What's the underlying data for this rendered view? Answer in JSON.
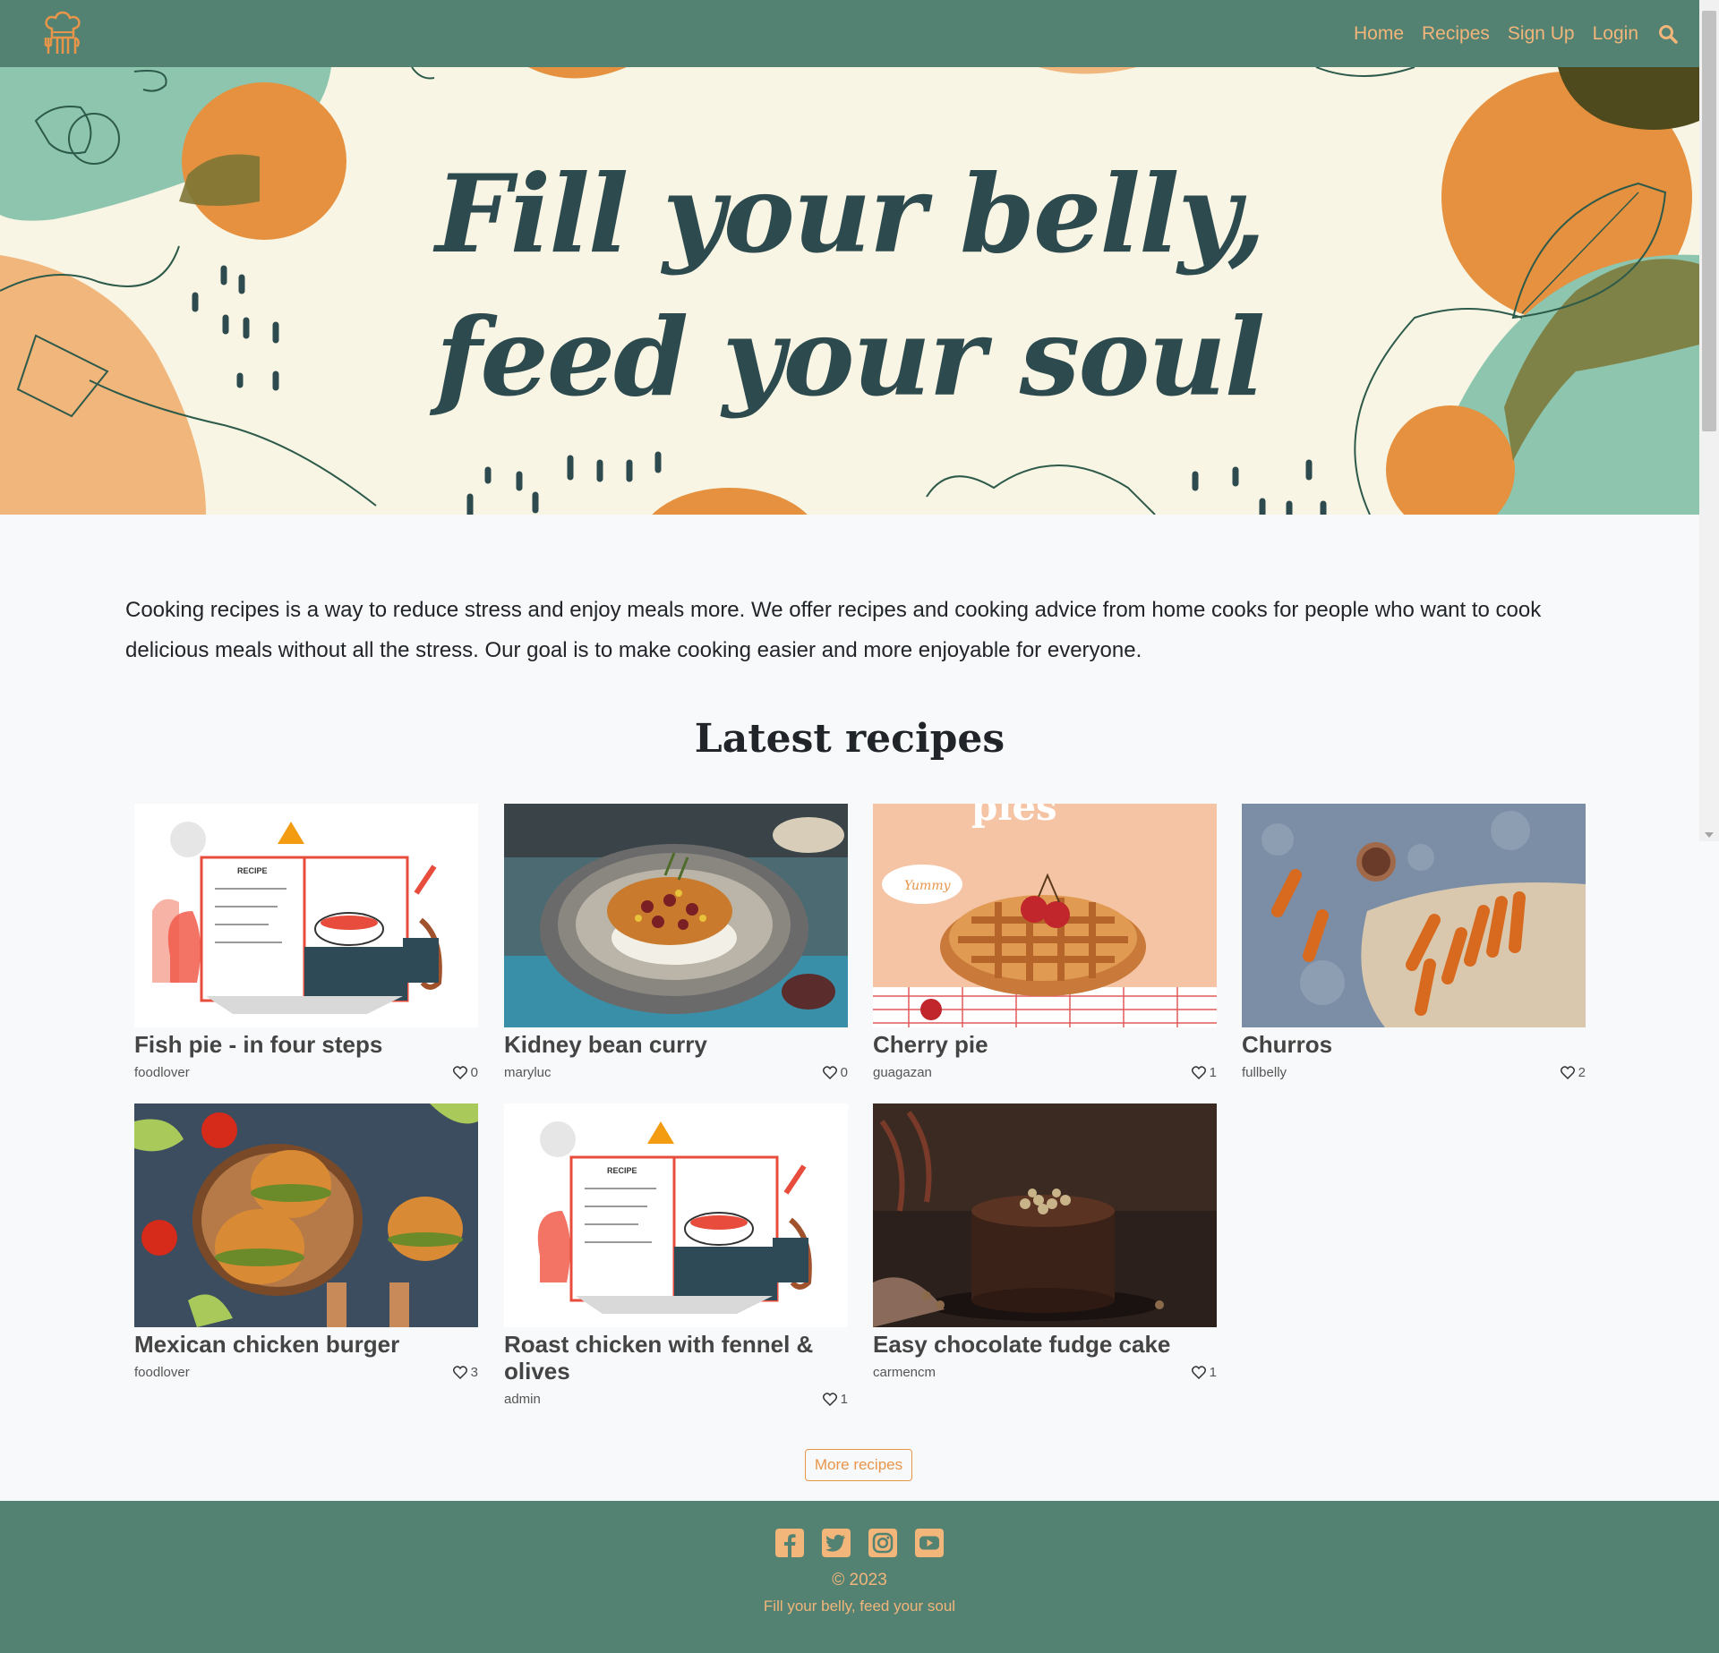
{
  "nav": {
    "logo_icon": "chef-hat-utensils-icon",
    "links": [
      "Home",
      "Recipes",
      "Sign Up",
      "Login"
    ],
    "search_icon": "search-icon",
    "link_color": "#f2b57a",
    "bg_color": "#538272"
  },
  "hero": {
    "title_line1": "Fill your belly,",
    "title_line2": "feed your soul"
  },
  "intro": "Cooking recipes is a way to reduce stress and enjoy meals more. We offer recipes and cooking advice from home cooks for people who want to cook delicious meals without all the stress. Our goal is to make cooking easier and more enjoyable for everyone.",
  "latest": {
    "heading": "Latest recipes",
    "recipes": [
      {
        "title": "Fish pie - in four steps",
        "author": "foodlover",
        "likes": "0",
        "image": "recipe-book-illustration"
      },
      {
        "title": "Kidney bean curry",
        "author": "maryluc",
        "likes": "0",
        "image": "bean-curry-bowl-photo"
      },
      {
        "title": "Cherry pie",
        "author": "guagazan",
        "likes": "1",
        "image": "cherry-pie-illustration"
      },
      {
        "title": "Churros",
        "author": "fullbelly",
        "likes": "2",
        "image": "churros-photo"
      },
      {
        "title": "Mexican chicken burger",
        "author": "foodlover",
        "likes": "3",
        "image": "burgers-photo"
      },
      {
        "title": "Roast chicken with fennel & olives",
        "author": "admin",
        "likes": "1",
        "image": "recipe-book-illustration"
      },
      {
        "title": "Easy chocolate fudge cake",
        "author": "carmencm",
        "likes": "1",
        "image": "chocolate-cake-photo"
      }
    ],
    "more_button": "More recipes"
  },
  "footer": {
    "social_icons": [
      "facebook-icon",
      "twitter-icon",
      "instagram-icon",
      "youtube-icon"
    ],
    "copyright": "© 2023",
    "tagline": "Fill your belly, feed your soul"
  }
}
